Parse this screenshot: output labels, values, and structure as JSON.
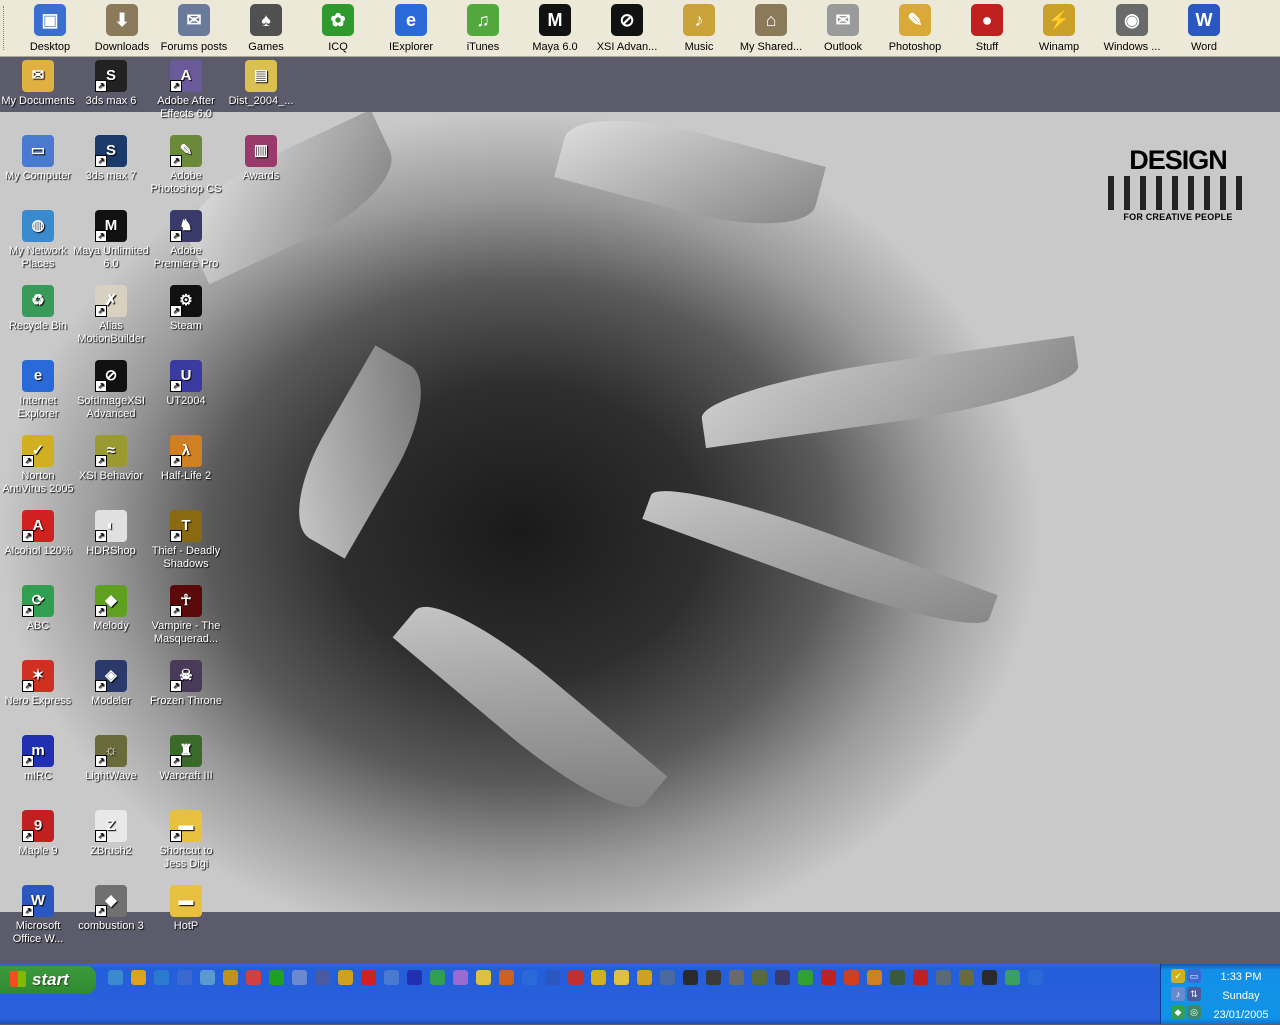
{
  "toolbar": {
    "items": [
      {
        "label": "Desktop",
        "icon": "desktop-icon",
        "color": "#3a6fd0",
        "glyph": "▣"
      },
      {
        "label": "Downloads",
        "icon": "downloads-folder-icon",
        "color": "#8a7a5a",
        "glyph": "⬇"
      },
      {
        "label": "Forums posts",
        "icon": "forums-folder-icon",
        "color": "#6a7a9a",
        "glyph": "✉"
      },
      {
        "label": "Games",
        "icon": "games-joystick-icon",
        "color": "#505050",
        "glyph": "♠"
      },
      {
        "label": "ICQ",
        "icon": "icq-flower-icon",
        "color": "#2e9a2e",
        "glyph": "✿"
      },
      {
        "label": "IExplorer",
        "icon": "internet-explorer-icon",
        "color": "#2a6ad8",
        "glyph": "e"
      },
      {
        "label": "iTunes",
        "icon": "itunes-icon",
        "color": "#52a83c",
        "glyph": "♫"
      },
      {
        "label": "Maya 6.0",
        "icon": "maya-icon",
        "color": "#111111",
        "glyph": "M"
      },
      {
        "label": "XSI Advan...",
        "icon": "xsi-icon",
        "color": "#111111",
        "glyph": "⊘"
      },
      {
        "label": "Music",
        "icon": "music-folder-icon",
        "color": "#c9a23a",
        "glyph": "♪"
      },
      {
        "label": "My Shared...",
        "icon": "shared-folder-icon",
        "color": "#8a7a5a",
        "glyph": "⌂"
      },
      {
        "label": "Outlook",
        "icon": "outlook-icon",
        "color": "#9a9a9a",
        "glyph": "✉"
      },
      {
        "label": "Photoshop",
        "icon": "photoshop-icon",
        "color": "#d9a93a",
        "glyph": "✎"
      },
      {
        "label": "Stuff",
        "icon": "stuff-icon",
        "color": "#c02020",
        "glyph": "●"
      },
      {
        "label": "Winamp",
        "icon": "winamp-icon",
        "color": "#c9a028",
        "glyph": "⚡"
      },
      {
        "label": "Windows ...",
        "icon": "windows-media-icon",
        "color": "#6a6a6a",
        "glyph": "◉"
      },
      {
        "label": "Word",
        "icon": "word-icon",
        "color": "#2a58c0",
        "glyph": "W"
      }
    ]
  },
  "desktop": {
    "logo": {
      "title": "DESIGN",
      "tagline": "FOR CREATIVE PEOPLE"
    },
    "icons": [
      {
        "label": "My Documents",
        "icon": "my-documents-icon",
        "color": "#e0b040",
        "glyph": "✉",
        "shortcut": false
      },
      {
        "label": "3ds max 6",
        "icon": "3ds-max-icon",
        "color": "#222222",
        "glyph": "S",
        "shortcut": true
      },
      {
        "label": "Adobe After Effects 6.0",
        "icon": "after-effects-icon",
        "color": "#6a5a9a",
        "glyph": "A",
        "shortcut": true
      },
      {
        "label": "Dist_2004_...",
        "icon": "zip-folder-icon",
        "color": "#d9c050",
        "glyph": "▤",
        "shortcut": false
      },
      {
        "label": "My Computer",
        "icon": "my-computer-icon",
        "color": "#4a7ad0",
        "glyph": "▭",
        "shortcut": false
      },
      {
        "label": "3ds max 7",
        "icon": "3ds-max-icon",
        "color": "#1a3a6a",
        "glyph": "S",
        "shortcut": true
      },
      {
        "label": "Adobe Photoshop CS",
        "icon": "photoshop-icon",
        "color": "#6a8a3a",
        "glyph": "✎",
        "shortcut": true
      },
      {
        "label": "Awards",
        "icon": "winrar-icon",
        "color": "#9a3a6a",
        "glyph": "▥",
        "shortcut": false
      },
      {
        "label": "My Network Places",
        "icon": "network-places-icon",
        "color": "#3a8ad0",
        "glyph": "◍",
        "shortcut": false
      },
      {
        "label": "Maya Unlimited 6.0",
        "icon": "maya-icon",
        "color": "#111111",
        "glyph": "M",
        "shortcut": true
      },
      {
        "label": "Adobe Premiere Pro",
        "icon": "premiere-icon",
        "color": "#3a3a6a",
        "glyph": "♞",
        "shortcut": true
      },
      {
        "label": "Recycle Bin",
        "icon": "recycle-bin-icon",
        "color": "#3a9a5a",
        "glyph": "♻",
        "shortcut": false
      },
      {
        "label": "Alias MotionBuilder",
        "icon": "motionbuilder-icon",
        "color": "#d8d0c0",
        "glyph": "✗",
        "shortcut": true
      },
      {
        "label": "Steam",
        "icon": "steam-icon",
        "color": "#111111",
        "glyph": "⚙",
        "shortcut": true
      },
      {
        "label": "Internet Explorer",
        "icon": "internet-explorer-icon",
        "color": "#2a6ad8",
        "glyph": "e",
        "shortcut": false
      },
      {
        "label": "SoftImageXSI Advanced",
        "icon": "xsi-icon",
        "color": "#111111",
        "glyph": "⊘",
        "shortcut": true
      },
      {
        "label": "UT2004",
        "icon": "ut2004-icon",
        "color": "#3a3aa0",
        "glyph": "U",
        "shortcut": true
      },
      {
        "label": "Norton AntiVirus 2005",
        "icon": "norton-icon",
        "color": "#d0b020",
        "glyph": "✓",
        "shortcut": true
      },
      {
        "label": "XSI Behavior",
        "icon": "xsi-behavior-icon",
        "color": "#9a9a30",
        "glyph": "≈",
        "shortcut": true
      },
      {
        "label": "Half-Life 2",
        "icon": "half-life-icon",
        "color": "#d08020",
        "glyph": "λ",
        "shortcut": true
      },
      {
        "label": "Alcohol 120%",
        "icon": "alcohol-icon",
        "color": "#d02020",
        "glyph": "A",
        "shortcut": true
      },
      {
        "label": "HDRShop",
        "icon": "hdrshop-icon",
        "color": "#e0e0e0",
        "glyph": "◐",
        "shortcut": true
      },
      {
        "label": "Thief - Deadly Shadows",
        "icon": "thief-icon",
        "color": "#8a6a10",
        "glyph": "T",
        "shortcut": true
      },
      {
        "label": "ABC",
        "icon": "abc-icon",
        "color": "#30a050",
        "glyph": "⟳",
        "shortcut": true
      },
      {
        "label": "Melody",
        "icon": "melody-icon",
        "color": "#60a020",
        "glyph": "◆",
        "shortcut": true
      },
      {
        "label": "Vampire - The Masquerad...",
        "icon": "vampire-icon",
        "color": "#5a0a0a",
        "glyph": "☥",
        "shortcut": true
      },
      {
        "label": "Nero Express",
        "icon": "nero-icon",
        "color": "#d03020",
        "glyph": "✶",
        "shortcut": true
      },
      {
        "label": "Modeler",
        "icon": "modeler-icon",
        "color": "#2a3a6a",
        "glyph": "◈",
        "shortcut": true
      },
      {
        "label": "Frozen Throne",
        "icon": "frozen-throne-icon",
        "color": "#4a3a5a",
        "glyph": "☠",
        "shortcut": true
      },
      {
        "label": "mIRC",
        "icon": "mirc-icon",
        "color": "#2030b0",
        "glyph": "m",
        "shortcut": true
      },
      {
        "label": "LightWave",
        "icon": "lightwave-icon",
        "color": "#6a6a3a",
        "glyph": "☼",
        "shortcut": true
      },
      {
        "label": "Warcraft III",
        "icon": "warcraft-icon",
        "color": "#3a6a2a",
        "glyph": "♜",
        "shortcut": true
      },
      {
        "label": "Maple 9",
        "icon": "maple-icon",
        "color": "#c02020",
        "glyph": "9",
        "shortcut": true
      },
      {
        "label": "ZBrush2",
        "icon": "zbrush-icon",
        "color": "#e8e8e8",
        "glyph": "Z",
        "shortcut": true
      },
      {
        "label": "Shortcut to Jess Digi",
        "icon": "folder-icon",
        "color": "#e8c040",
        "glyph": "▬",
        "shortcut": true
      },
      {
        "label": "Microsoft Office W...",
        "icon": "word-icon",
        "color": "#2a58c0",
        "glyph": "W",
        "shortcut": true
      },
      {
        "label": "combustion 3",
        "icon": "combustion-icon",
        "color": "#707070",
        "glyph": "◆",
        "shortcut": true
      },
      {
        "label": "HotP",
        "icon": "folder-icon",
        "color": "#e8c040",
        "glyph": "▬",
        "shortcut": false
      }
    ]
  },
  "taskbar": {
    "start_label": "start",
    "quicklaunch_colors": [
      "#3a8ad0",
      "#e0a020",
      "#2a7ad0",
      "#3a6ad0",
      "#5a9ad0",
      "#c09020",
      "#d04040",
      "#20a020",
      "#6a8ad0",
      "#4a5aa0",
      "#d0a020",
      "#d02020",
      "#4a7ad0",
      "#2030b0",
      "#30a050",
      "#9a6ad0",
      "#e0c040",
      "#d06020",
      "#2a6ad8",
      "#2a58c0",
      "#c03030",
      "#d0b020",
      "#e0c040",
      "#d0a020",
      "#4a6aa0",
      "#2a2a2a",
      "#3a3a3a",
      "#6a6a6a",
      "#5a6a3a",
      "#3a3a6a",
      "#30a030",
      "#c02020",
      "#d04020",
      "#d08020",
      "#3a5a3a",
      "#c02020",
      "#5a6a7a",
      "#6a6a3a",
      "#2a2a2a",
      "#3aa060",
      "#2a6ad8"
    ],
    "tray": {
      "time": "1:33 PM",
      "day": "Sunday",
      "date": "23/01/2005"
    }
  }
}
